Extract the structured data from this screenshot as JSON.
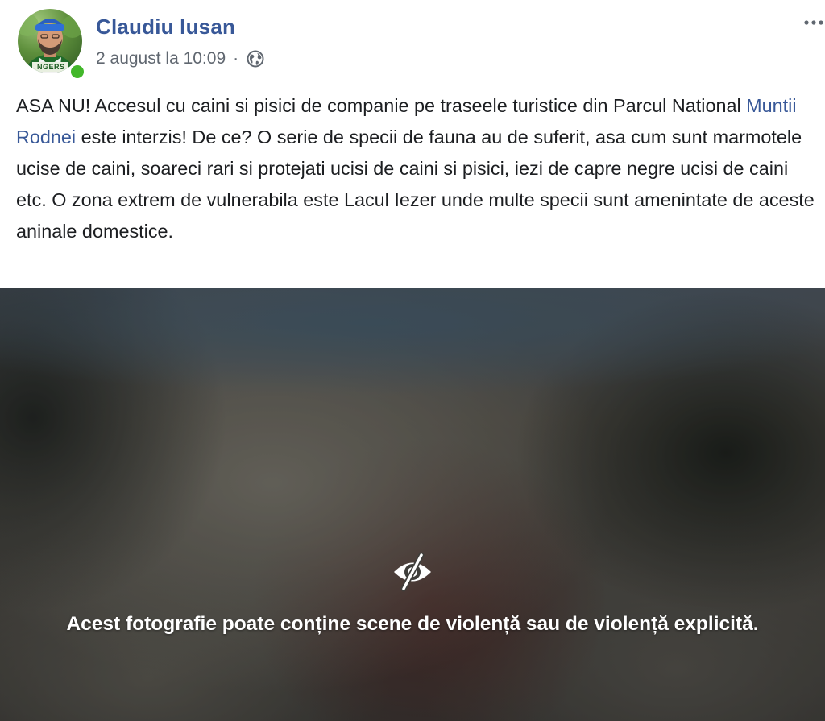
{
  "post": {
    "author": {
      "name": "Claudiu Iusan",
      "avatar_icon": "profile-photo",
      "avatar_badge_text": "NGERS",
      "online": true,
      "online_color": "#42b72a"
    },
    "meta": {
      "timestamp": "2 august la 10:09",
      "separator": "·",
      "audience_icon": "globe-icon"
    },
    "more_icon": "more-horizontal-icon",
    "text": {
      "part1": "ASA NU! Accesul cu caini si pisici de companie pe traseele turistice din Parcul National ",
      "link": "Muntii Rodnei",
      "part2": " este interzis! De ce? O serie de specii de fauna au de suferit, asa cum sunt marmotele ucise de caini, soareci rari si protejati ucisi de caini si pisici, iezi de capre negre ucisi de caini etc. O zona extrem de vulnerabila este Lacul Iezer unde multe specii sunt amenintate de aceste aninale domestice."
    },
    "media": {
      "hidden_icon": "eye-slash-icon",
      "warning": "Acest fotografie poate conține scene de violență sau de violență explicită."
    },
    "colors": {
      "name": "#385898",
      "meta": "#606770",
      "text": "#1c1e21",
      "link": "#385898"
    }
  }
}
